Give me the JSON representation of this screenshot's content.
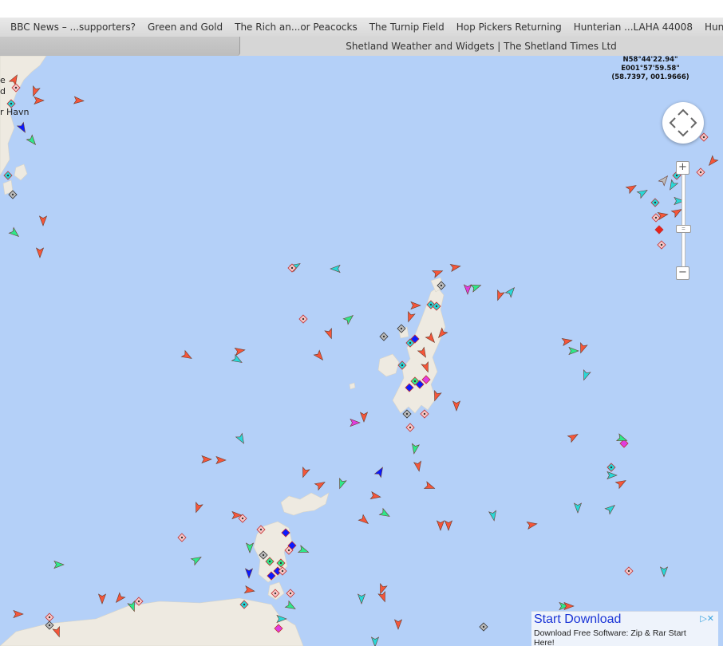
{
  "bookmarks": [
    "BBC News – ...supporters?",
    "Green and Gold",
    "The Rich an...or Peacocks",
    "The Turnip Field",
    "Hop Pickers Returning",
    "Hunterian ...LAHA 44008",
    "Hunterian"
  ],
  "active_tab_title": "Shetland Weather and Widgets | The Shetland Times Ltd",
  "map": {
    "coordinates": {
      "lat": "N58°44'22.94\"",
      "lon": "E001°57'59.58\"",
      "decimal": "(58.7397, 001.9666)"
    },
    "place_labels": [
      "e",
      "d",
      "r Havn"
    ],
    "controls": {
      "zoom_in": "+",
      "zoom_out": "−",
      "zoom_handle": "="
    },
    "vessel_colors": {
      "cargo": "#2ee88a",
      "tanker": "#f5563a",
      "passenger": "#0a1aff",
      "highspeed": "#e8e83a",
      "tug_special": "#28d8d8",
      "fishing": "#f79c8e",
      "pleasure": "#e03ce0",
      "unknown": "#bdbdbd",
      "navaid": "#f9c9c9"
    }
  },
  "ad": {
    "title": "Start Download",
    "body": "Download Free Software: Zip & Rar Start Here!",
    "choice_icon": "adchoices-icon",
    "close_icon": "close-icon"
  }
}
